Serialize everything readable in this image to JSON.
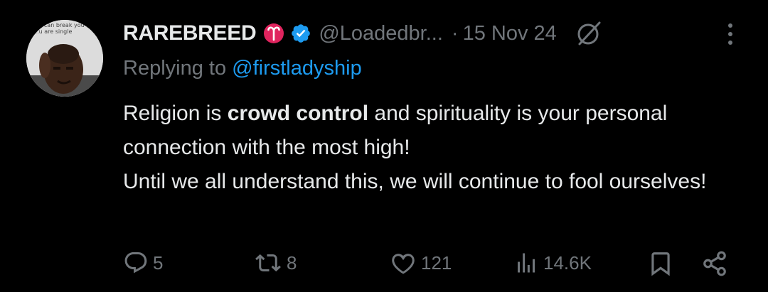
{
  "avatar": {
    "meme_caption": "...y can break you\n...u are single"
  },
  "header": {
    "display_name": "RAREBREED",
    "handle": "@Loadedbr...",
    "separator": "·",
    "date": "15 Nov 24"
  },
  "reply": {
    "prefix": "Replying to ",
    "mention": "@firstladyship"
  },
  "tweet": {
    "text_part1": "Religion is ",
    "text_bold": "crowd control",
    "text_part2": " and spirituality is your personal connection with the most high!",
    "text_line3": "Until we all understand this, we will continue to fool ourselves!"
  },
  "actions": {
    "replies": "5",
    "reposts": "8",
    "likes": "121",
    "views": "14.6K"
  },
  "colors": {
    "background": "#000000",
    "text": "#e7e9ea",
    "muted": "#71767b",
    "accent": "#1d9bf0",
    "aries_badge": "#e0245e"
  },
  "icons": [
    "aries-icon",
    "verified-icon",
    "grok-icon",
    "more-icon",
    "reply-icon",
    "repost-icon",
    "like-icon",
    "views-icon",
    "bookmark-icon",
    "share-icon"
  ]
}
